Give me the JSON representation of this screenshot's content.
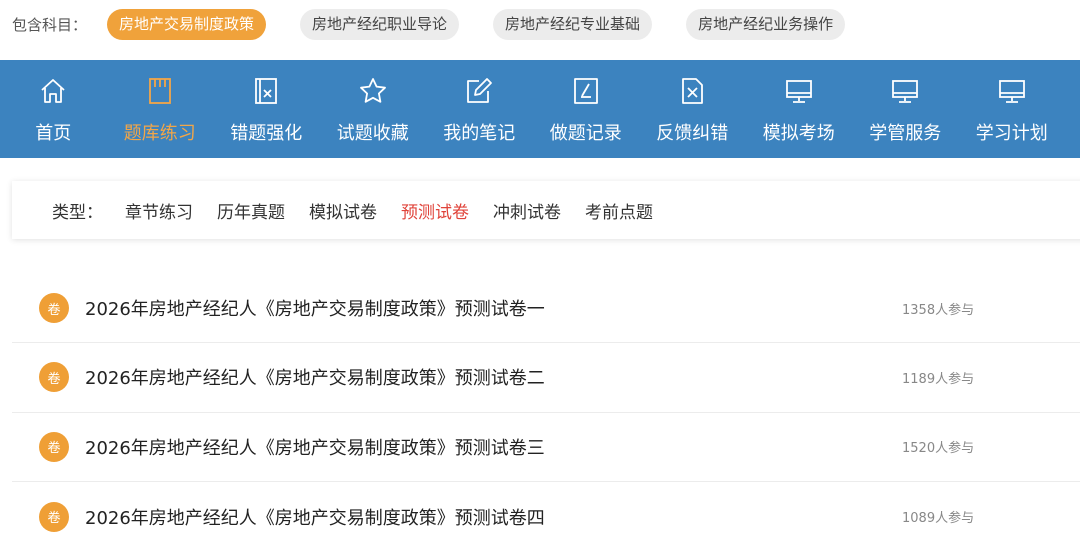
{
  "subjects": {
    "label": "包含科目：",
    "items": [
      {
        "label": "房地产交易制度政策",
        "active": true
      },
      {
        "label": "房地产经纪职业导论",
        "active": false
      },
      {
        "label": "房地产经纪专业基础",
        "active": false
      },
      {
        "label": "房地产经纪业务操作",
        "active": false
      }
    ]
  },
  "nav": {
    "items": [
      {
        "label": "首页",
        "icon": "home-icon",
        "active": false
      },
      {
        "label": "题库练习",
        "icon": "book-icon",
        "active": true
      },
      {
        "label": "错题强化",
        "icon": "wrong-answer-icon",
        "active": false
      },
      {
        "label": "试题收藏",
        "icon": "star-icon",
        "active": false
      },
      {
        "label": "我的笔记",
        "icon": "edit-note-icon",
        "active": false
      },
      {
        "label": "做题记录",
        "icon": "record-icon",
        "active": false
      },
      {
        "label": "反馈纠错",
        "icon": "feedback-icon",
        "active": false
      },
      {
        "label": "模拟考场",
        "icon": "monitor-icon",
        "active": false
      },
      {
        "label": "学管服务",
        "icon": "monitor-icon",
        "active": false
      },
      {
        "label": "学习计划",
        "icon": "monitor-icon",
        "active": false
      }
    ],
    "accent": "#f2a648",
    "background": "#3c83bf"
  },
  "types": {
    "label": "类型：",
    "items": [
      {
        "label": "章节练习",
        "active": false
      },
      {
        "label": "历年真题",
        "active": false
      },
      {
        "label": "模拟试卷",
        "active": false
      },
      {
        "label": "预测试卷",
        "active": true
      },
      {
        "label": "冲刺试卷",
        "active": false
      },
      {
        "label": "考前点题",
        "active": false
      }
    ],
    "active_color": "#e0433a"
  },
  "papers": [
    {
      "badge": "卷",
      "title": "2026年房地产经纪人《房地产交易制度政策》预测试卷一",
      "participants": "1358人参与"
    },
    {
      "badge": "卷",
      "title": "2026年房地产经纪人《房地产交易制度政策》预测试卷二",
      "participants": "1189人参与"
    },
    {
      "badge": "卷",
      "title": "2026年房地产经纪人《房地产交易制度政策》预测试卷三",
      "participants": "1520人参与"
    },
    {
      "badge": "卷",
      "title": "2026年房地产经纪人《房地产交易制度政策》预测试卷四",
      "participants": "1089人参与"
    }
  ]
}
